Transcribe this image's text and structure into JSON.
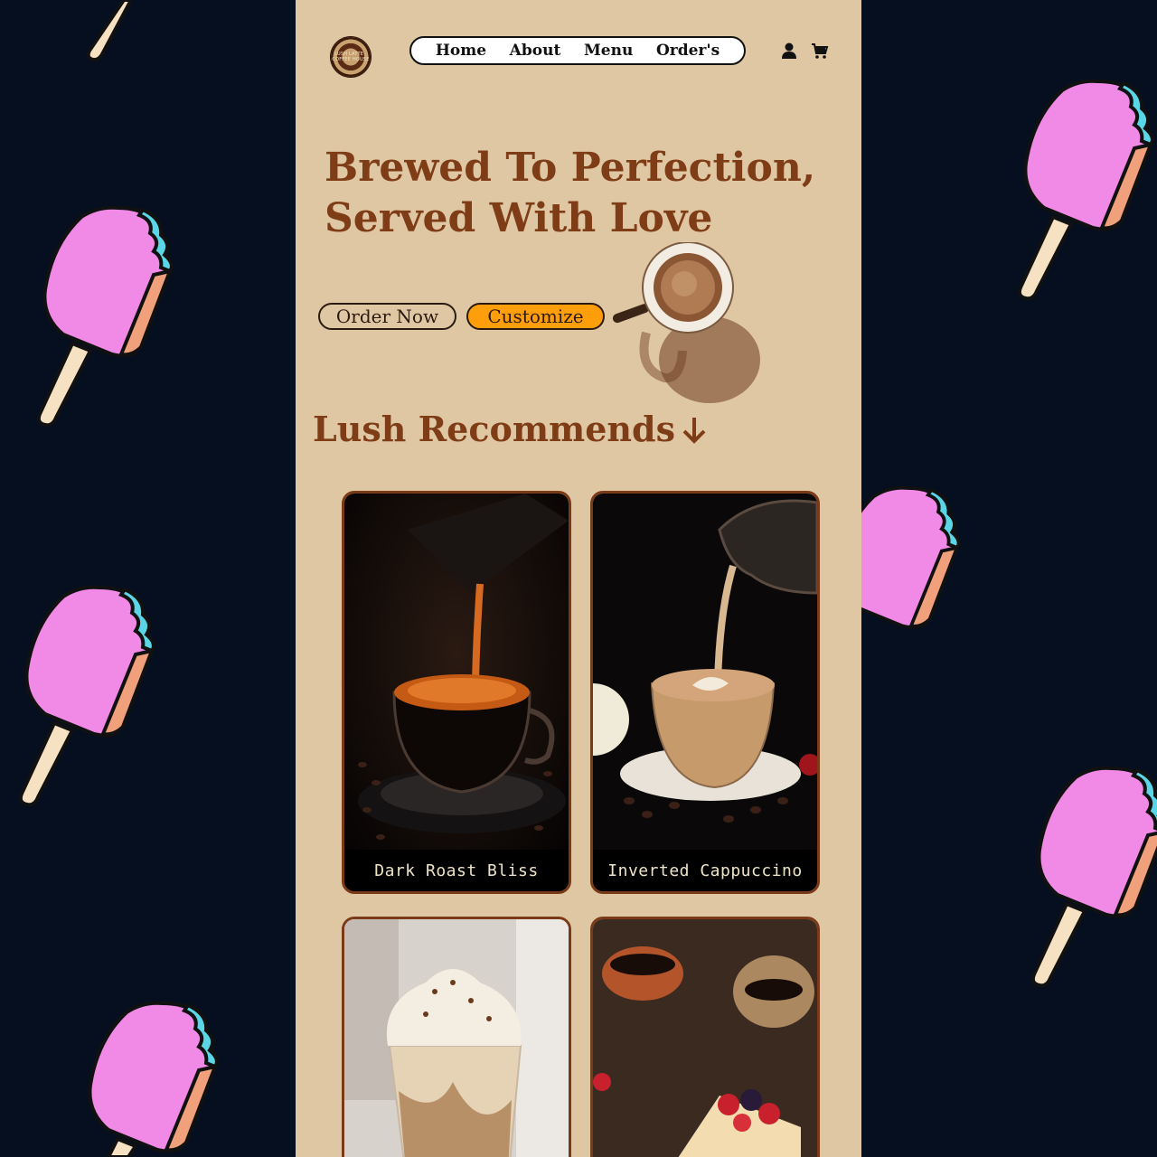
{
  "logo": {
    "text": "LUSH LATTE · COFFEE HOUSE"
  },
  "nav": {
    "items": [
      "Home",
      "About",
      "Menu",
      "Order's"
    ]
  },
  "header_icons": [
    "user-icon",
    "cart-icon"
  ],
  "hero": {
    "title_line1": "Brewed To Perfection,",
    "title_line2": "Served With Love",
    "order_now_label": "Order Now",
    "customize_label": "Customize"
  },
  "recommends": {
    "title": "Lush Recommends",
    "cards": [
      {
        "label": "Dark Roast Bliss"
      },
      {
        "label": "Inverted Cappuccino"
      },
      {
        "label": ""
      },
      {
        "label": ""
      }
    ]
  },
  "colors": {
    "page_bg": "#050f1f",
    "phone_bg": "#e0c7a4",
    "accent_brown": "#7f3d17",
    "customize_orange": "#ff9e0b",
    "popsicle_pink": "#f08ae6",
    "popsicle_blue": "#5ad6e6",
    "popsicle_peach": "#f0a07a"
  }
}
